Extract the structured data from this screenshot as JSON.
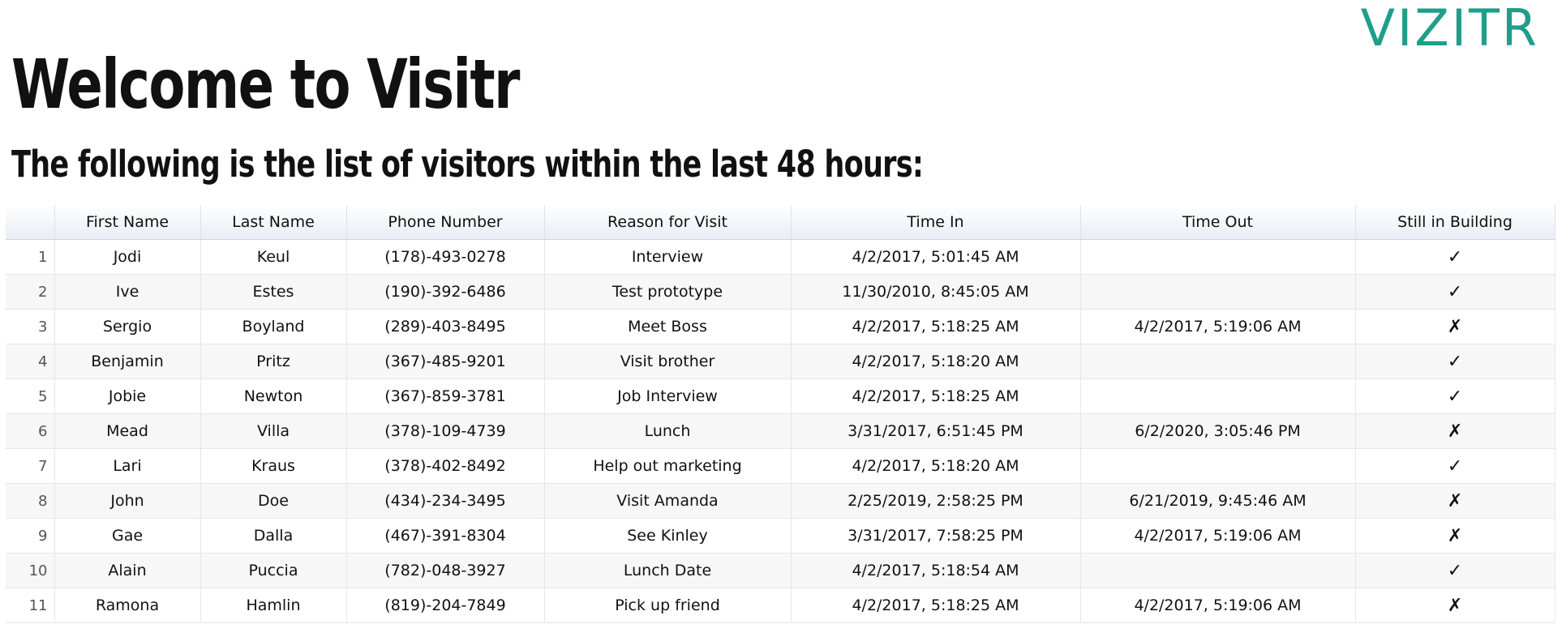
{
  "logo": "VIZITR",
  "title": "Welcome to Visitr",
  "subtitle": "The following is the list of visitors within the last 48 hours:",
  "accent_color": "#1f9e8a",
  "table": {
    "columns": [
      "",
      "First Name",
      "Last Name",
      "Phone Number",
      "Reason for Visit",
      "Time In",
      "Time Out",
      "Still in Building"
    ],
    "rows": [
      {
        "num": "1",
        "first": "Jodi",
        "last": "Keul",
        "phone": "(178)-493-0278",
        "reason": "Interview",
        "time_in": "4/2/2017, 5:01:45 AM",
        "time_out": "",
        "still": "✓"
      },
      {
        "num": "2",
        "first": "Ive",
        "last": "Estes",
        "phone": "(190)-392-6486",
        "reason": "Test prototype",
        "time_in": "11/30/2010, 8:45:05 AM",
        "time_out": "",
        "still": "✓"
      },
      {
        "num": "3",
        "first": "Sergio",
        "last": "Boyland",
        "phone": "(289)-403-8495",
        "reason": "Meet Boss",
        "time_in": "4/2/2017, 5:18:25 AM",
        "time_out": "4/2/2017, 5:19:06 AM",
        "still": "✗"
      },
      {
        "num": "4",
        "first": "Benjamin",
        "last": "Pritz",
        "phone": "(367)-485-9201",
        "reason": "Visit brother",
        "time_in": "4/2/2017, 5:18:20 AM",
        "time_out": "",
        "still": "✓"
      },
      {
        "num": "5",
        "first": "Jobie",
        "last": "Newton",
        "phone": "(367)-859-3781",
        "reason": "Job Interview",
        "time_in": "4/2/2017, 5:18:25 AM",
        "time_out": "",
        "still": "✓"
      },
      {
        "num": "6",
        "first": "Mead",
        "last": "Villa",
        "phone": "(378)-109-4739",
        "reason": "Lunch",
        "time_in": "3/31/2017, 6:51:45 PM",
        "time_out": "6/2/2020, 3:05:46 PM",
        "still": "✗"
      },
      {
        "num": "7",
        "first": "Lari",
        "last": "Kraus",
        "phone": "(378)-402-8492",
        "reason": "Help out marketing",
        "time_in": "4/2/2017, 5:18:20 AM",
        "time_out": "",
        "still": "✓"
      },
      {
        "num": "8",
        "first": "John",
        "last": "Doe",
        "phone": "(434)-234-3495",
        "reason": "Visit Amanda",
        "time_in": "2/25/2019, 2:58:25 PM",
        "time_out": "6/21/2019, 9:45:46 AM",
        "still": "✗"
      },
      {
        "num": "9",
        "first": "Gae",
        "last": "Dalla",
        "phone": "(467)-391-8304",
        "reason": "See Kinley",
        "time_in": "3/31/2017, 7:58:25 PM",
        "time_out": "4/2/2017, 5:19:06 AM",
        "still": "✗"
      },
      {
        "num": "10",
        "first": "Alain",
        "last": "Puccia",
        "phone": "(782)-048-3927",
        "reason": "Lunch Date",
        "time_in": "4/2/2017, 5:18:54 AM",
        "time_out": "",
        "still": "✓"
      },
      {
        "num": "11",
        "first": "Ramona",
        "last": "Hamlin",
        "phone": "(819)-204-7849",
        "reason": "Pick up friend",
        "time_in": "4/2/2017, 5:18:25 AM",
        "time_out": "4/2/2017, 5:19:06 AM",
        "still": "✗"
      }
    ]
  }
}
